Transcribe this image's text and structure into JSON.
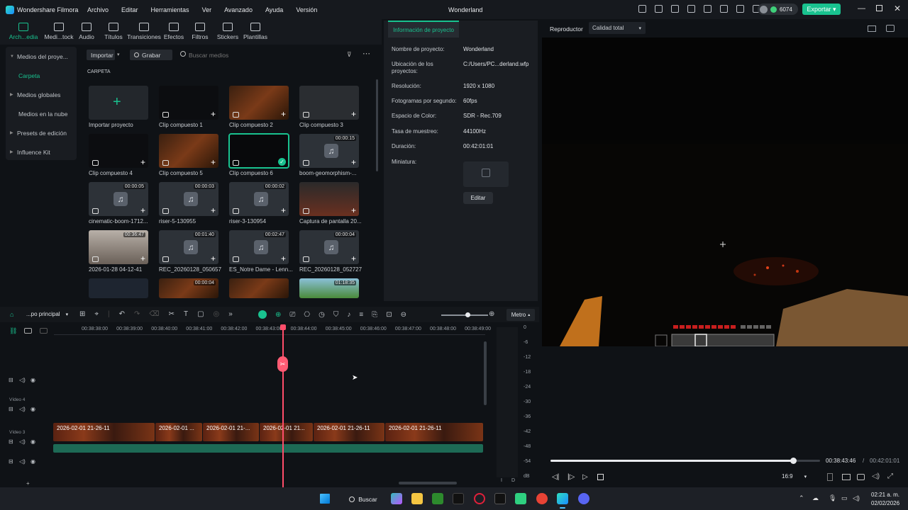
{
  "app": {
    "name": "Wondershare Filmora",
    "project": "Wonderland",
    "credits": "6074",
    "export": "Exportar"
  },
  "menu": [
    "Archivo",
    "Editar",
    "Herramientas",
    "Ver",
    "Avanzado",
    "Ayuda",
    "Versión"
  ],
  "toolbar": [
    "Arch...edia",
    "Medi...tock",
    "Audio",
    "Títulos",
    "Transiciones",
    "Efectos",
    "Filtros",
    "Stickers",
    "Plantillas"
  ],
  "sidebar": {
    "items": [
      "Medios del proye...",
      "Carpeta",
      "Medios globales",
      "Medios en la nube",
      "Presets de edición",
      "Influence Kit"
    ]
  },
  "media": {
    "import": "Importar",
    "record": "Grabar",
    "search_placeholder": "Buscar medios",
    "folder": "CARPETA",
    "items": [
      {
        "label": "Importar proyecto",
        "dur": ""
      },
      {
        "label": "Clip compuesto 1",
        "dur": ""
      },
      {
        "label": "Clip compuesto 2",
        "dur": ""
      },
      {
        "label": "Clip compuesto 3",
        "dur": ""
      },
      {
        "label": "Clip compuesto 4",
        "dur": ""
      },
      {
        "label": "Clip compuesto 5",
        "dur": ""
      },
      {
        "label": "Clip compuesto 6",
        "dur": ""
      },
      {
        "label": "boom-geomorphism-...",
        "dur": "00:00:15"
      },
      {
        "label": "cinematic-boom-1712...",
        "dur": "00:00:05"
      },
      {
        "label": "riser-5-130955",
        "dur": "00:00:03"
      },
      {
        "label": "riser-3-130954",
        "dur": "00:00:02"
      },
      {
        "label": "Captura de pantalla 20...",
        "dur": ""
      },
      {
        "label": "2026-01-28 04-12-41",
        "dur": "00:36:47"
      },
      {
        "label": "REC_20260128_050657",
        "dur": "00:01:40"
      },
      {
        "label": "ES_Notre Dame - Lenn...",
        "dur": "00:02:47"
      },
      {
        "label": "REC_20260128_052727",
        "dur": "00:00:04"
      },
      {
        "label": "",
        "dur": ""
      },
      {
        "label": "",
        "dur": "00:00:04"
      },
      {
        "label": "",
        "dur": ""
      },
      {
        "label": "",
        "dur": "01:18:35"
      }
    ]
  },
  "info": {
    "tab": "Información de proyecto",
    "rows": [
      {
        "label": "Nombre de proyecto:",
        "value": "Wonderland"
      },
      {
        "label": "Ubicación de los proyectos:",
        "value": "C:/Users/PC...derland.wfp"
      },
      {
        "label": "Resolución:",
        "value": "1920 x 1080"
      },
      {
        "label": "Fotogramas por segundo:",
        "value": "60fps"
      },
      {
        "label": "Espacio de Color:",
        "value": "SDR - Rec.709"
      },
      {
        "label": "Tasa de muestreo:",
        "value": "44100Hz"
      },
      {
        "label": "Duración:",
        "value": "00:42:01:01"
      },
      {
        "label": "Miniatura:",
        "value": ""
      }
    ],
    "edit": "Editar"
  },
  "player": {
    "label": "Reproductor",
    "quality": "Calidad total",
    "current": "00:38:43:46",
    "total": "00:42:01:01",
    "ratio": "16:9",
    "progress": 0.9
  },
  "timeline": {
    "sequence": "...po principal",
    "meter": "Metro",
    "ticks": [
      "00:38:38:00",
      "00:38:39:00",
      "00:38:40:00",
      "00:38:41:00",
      "00:38:42:00",
      "00:38:43:00",
      "00:38:44:00",
      "00:38:45:00",
      "00:38:46:00",
      "00:38:47:00",
      "00:38:48:00",
      "00:38:49:00"
    ],
    "tracks": [
      "Vídeo 4",
      "Vídeo 3"
    ],
    "clips": [
      "2026-02-01 21-26-11",
      "2026-02-01 ...",
      "2026-02-01 21-...",
      "2026-02-01 21...",
      "2026-02-01 21-26-11",
      "2026-02-01 21-26-11"
    ],
    "db": [
      "0",
      "-6",
      "-12",
      "-18",
      "-24",
      "-30",
      "-36",
      "-42",
      "-48",
      "-54",
      "dB"
    ],
    "lr": [
      "I",
      "D"
    ]
  },
  "taskbar": {
    "search": "Buscar",
    "time": "02:21 a. m.",
    "date": "02/02/2026"
  }
}
